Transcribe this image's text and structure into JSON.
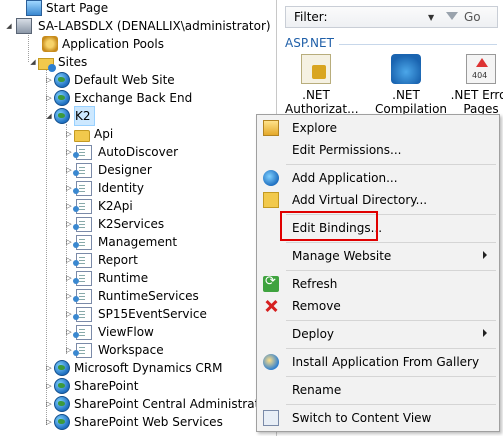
{
  "tree": {
    "start_page": "Start Page",
    "server": "SA-LABSDLX (DENALLIX\\administrator)",
    "app_pools": "Application Pools",
    "sites": "Sites",
    "site_items": [
      "Default Web Site",
      "Exchange Back End",
      "K2"
    ],
    "k2_children": [
      "Api",
      "AutoDiscover",
      "Designer",
      "Identity",
      "K2Api",
      "K2Services",
      "Management",
      "Report",
      "Runtime",
      "RuntimeServices",
      "SP15EventService",
      "ViewFlow",
      "Workspace"
    ],
    "after_items": [
      "Microsoft Dynamics CRM",
      "SharePoint",
      "SharePoint Central Administration",
      "SharePoint Web Services"
    ]
  },
  "pane": {
    "filter_label": "Filter:",
    "go_label": "Go",
    "group_title": "ASP.NET",
    "features": [
      {
        "line1": ".NET",
        "line2": "Authorizat...",
        "icon": "lock-icon"
      },
      {
        "line1": ".NET",
        "line2": "Compilation",
        "icon": "compilation-icon"
      },
      {
        "line1": ".NET Error",
        "line2": "Pages",
        "icon": "error-pages-icon"
      }
    ]
  },
  "menu": {
    "explore": "Explore",
    "edit_permissions": "Edit Permissions...",
    "add_application": "Add Application...",
    "add_virtual_directory": "Add Virtual Directory...",
    "edit_bindings": "Edit Bindings...",
    "manage_website": "Manage Website",
    "refresh": "Refresh",
    "remove": "Remove",
    "deploy": "Deploy",
    "install_gallery": "Install Application From Gallery",
    "rename": "Rename",
    "switch_content": "Switch to Content View"
  },
  "colors": {
    "highlight_box": "#e00000",
    "group_title": "#1f5fa8",
    "selection": "#cce8ff"
  }
}
